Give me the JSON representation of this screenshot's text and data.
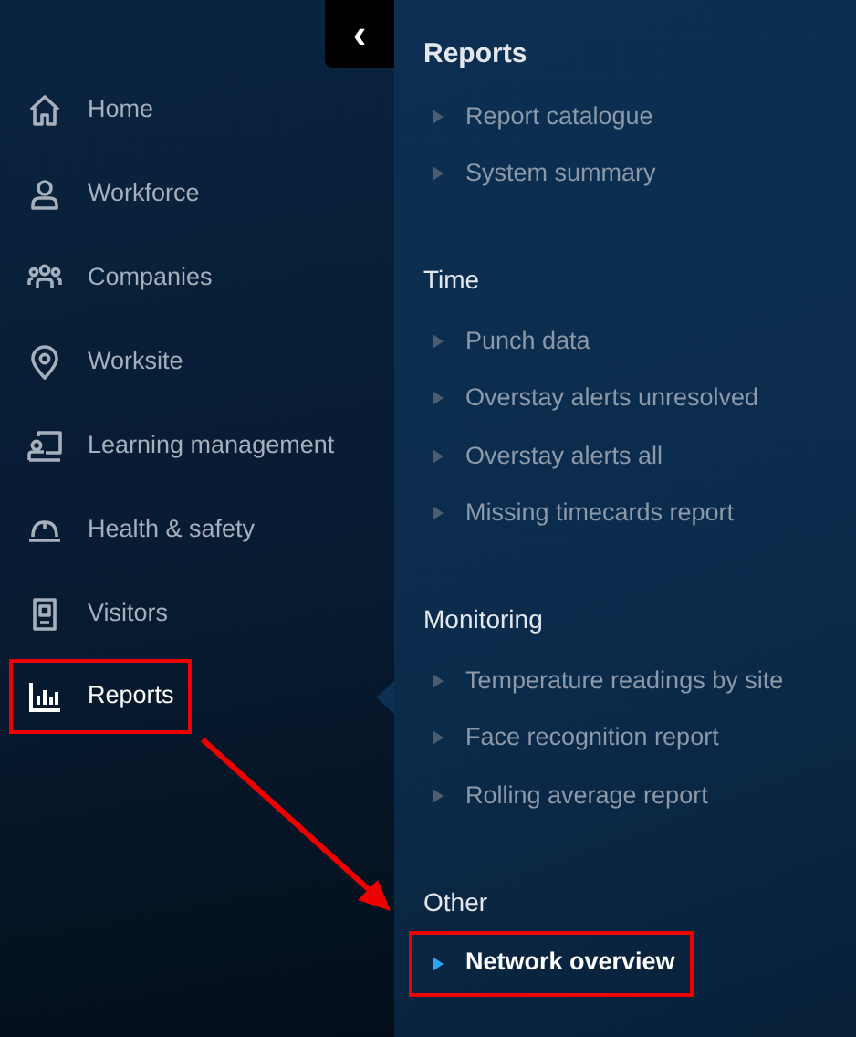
{
  "collapse_button": {
    "label": "‹"
  },
  "nav_items": [
    {
      "label": "Home",
      "selected": false,
      "highlighted": false
    },
    {
      "label": "Workforce",
      "selected": false,
      "highlighted": false
    },
    {
      "label": "Companies",
      "selected": false,
      "highlighted": false
    },
    {
      "label": "Worksite",
      "selected": false,
      "highlighted": false
    },
    {
      "label": "Learning management",
      "selected": false,
      "highlighted": false
    },
    {
      "label": "Health & safety",
      "selected": false,
      "highlighted": false
    },
    {
      "label": "Visitors",
      "selected": false,
      "highlighted": false
    },
    {
      "label": "Reports",
      "selected": true,
      "highlighted": true
    }
  ],
  "submenu": [
    {
      "title": "Reports",
      "items": [
        {
          "label": "Report catalogue",
          "selected": false,
          "highlighted": false
        },
        {
          "label": "System summary",
          "selected": false,
          "highlighted": false
        }
      ]
    },
    {
      "title": "Time",
      "items": [
        {
          "label": "Punch data",
          "selected": false,
          "highlighted": false
        },
        {
          "label": "Overstay alerts unresolved",
          "selected": false,
          "highlighted": false
        },
        {
          "label": "Overstay alerts all",
          "selected": false,
          "highlighted": false
        },
        {
          "label": "Missing timecards report",
          "selected": false,
          "highlighted": false
        }
      ]
    },
    {
      "title": "Monitoring",
      "items": [
        {
          "label": "Temperature readings by site",
          "selected": false,
          "highlighted": false
        },
        {
          "label": "Face recognition report",
          "selected": false,
          "highlighted": false
        },
        {
          "label": "Rolling average report",
          "selected": false,
          "highlighted": false
        }
      ]
    },
    {
      "title": "Other",
      "items": [
        {
          "label": "Network overview",
          "selected": true,
          "highlighted": true
        }
      ]
    }
  ],
  "annotation_arrow": true
}
